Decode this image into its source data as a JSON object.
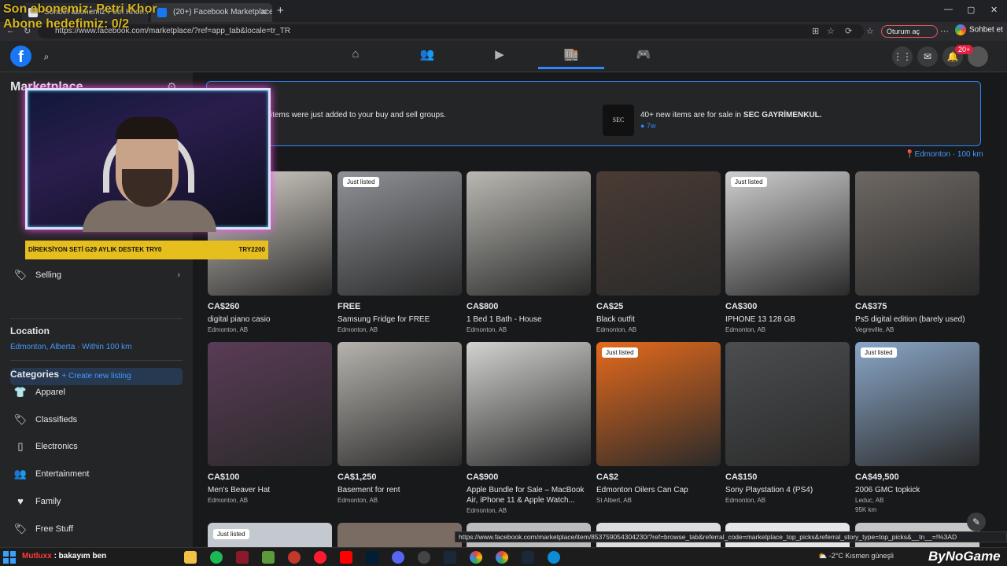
{
  "browser": {
    "tabs": [
      {
        "label": "Sohbet abonemiz Petri Khor... Oyun"
      },
      {
        "label": "(20+) Facebook Marketplace | Fac"
      }
    ],
    "url": "https://www.facebook.com/marketplace/?ref=app_tab&locale=tr_TR",
    "signin_label": "Oturum aç",
    "chat_label": "Sohbet et"
  },
  "overlay": {
    "line1": "Son abonemiz: Petri Khor",
    "line2": "Abone hedefimiz: 0/2",
    "ticker_left": "DİREKSİYON SETİ G29 AYLIK DESTEK TRY0",
    "ticker_right": "TRY2200"
  },
  "header": {
    "notification_count": "20+"
  },
  "sidebar": {
    "title": "Marketplace",
    "selling_label": "Selling",
    "create_listing_label": "+ Create new listing",
    "location_heading": "Location",
    "location_value": "Edmonton, Alberta · Within 100 km",
    "categories_heading": "Categories",
    "categories": [
      {
        "label": "Apparel",
        "icon": "shirt-icon"
      },
      {
        "label": "Classifieds",
        "icon": "tag-icon"
      },
      {
        "label": "Electronics",
        "icon": "phone-icon"
      },
      {
        "label": "Entertainment",
        "icon": "people-icon"
      },
      {
        "label": "Family",
        "icon": "heart-icon"
      },
      {
        "label": "Free Stuff",
        "icon": "tag-icon"
      }
    ]
  },
  "banner": {
    "left_text": "items were just added to your buy and sell groups.",
    "right_thumb": "SEC",
    "right_text_prefix": "40+ new items are for sale in ",
    "right_text_group": "SEC GAYRİMENKUL.",
    "right_time": "● 7w"
  },
  "location_filter": "Edmonton · 100 km",
  "listings": [
    {
      "price": "CA$260",
      "title": "digital piano casio",
      "city": "Edmonton, AB",
      "just_listed": false,
      "color": "#d9d4cc"
    },
    {
      "price": "FREE",
      "title": "Samsung Fridge for FREE",
      "city": "Edmonton, AB",
      "just_listed": true,
      "color": "#8f9297"
    },
    {
      "price": "CA$800",
      "title": "1 Bed 1 Bath - House",
      "city": "Edmonton, AB",
      "just_listed": false,
      "color": "#b9b8b2"
    },
    {
      "price": "CA$25",
      "title": "Black outfit",
      "city": "Edmonton, AB",
      "just_listed": false,
      "color": "#4a3b34"
    },
    {
      "price": "CA$300",
      "title": "IPHONE 13 128 GB",
      "city": "Edmonton, AB",
      "just_listed": true,
      "color": "#cfcfcf"
    },
    {
      "price": "CA$375",
      "title": "Ps5 digital edition (barely used)",
      "city": "Vegreville, AB",
      "just_listed": false,
      "color": "#6e6863"
    },
    {
      "price": "CA$100",
      "title": "Men's Beaver Hat",
      "city": "Edmonton, AB",
      "just_listed": false,
      "color": "#5a3b56"
    },
    {
      "price": "CA$1,250",
      "title": "Basement for rent",
      "city": "Edmonton, AB",
      "just_listed": false,
      "color": "#b6b3ad"
    },
    {
      "price": "CA$900",
      "title": "Apple Bundle for Sale – MacBook Air, iPhone 11 & Apple Watch...",
      "city": "Edmonton, AB",
      "just_listed": false,
      "color": "#d2d2d0"
    },
    {
      "price": "CA$2",
      "title": "Edmonton Oilers Can Cap",
      "city": "St Albert, AB",
      "just_listed": true,
      "color": "#e56a1c"
    },
    {
      "price": "CA$150",
      "title": "Sony Playstation 4 (PS4)",
      "city": "Edmonton, AB",
      "just_listed": false,
      "color": "#4b4d50"
    },
    {
      "price": "CA$49,500",
      "title": "2006 GMC topkick",
      "city": "Leduc, AB",
      "extra": "95K km",
      "just_listed": true,
      "color": "#8aa7c8"
    }
  ],
  "just_listed_label": "Just listed",
  "status_url": "https://www.facebook.com/marketplace/item/853759054304230/?ref=browse_tab&referral_code=marketplace_top_picks&referral_story_type=top_picks&__tn__=!%3AD",
  "taskbar": {
    "user_name": "Mutluxx",
    "message": ": bakayım ben",
    "weather": "-2°C  Kısmen güneşli",
    "brand": "ByNoGame"
  }
}
